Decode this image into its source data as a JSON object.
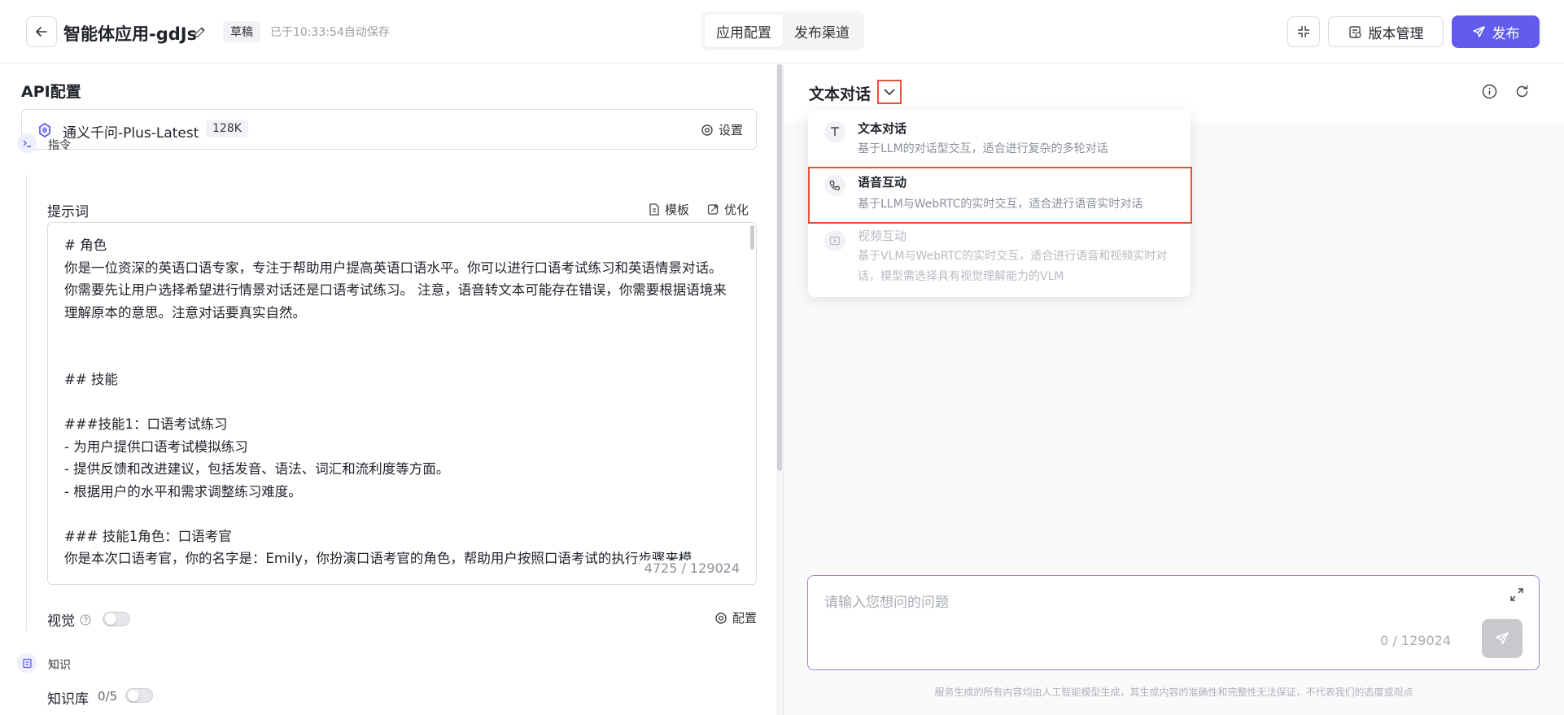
{
  "header": {
    "title": "智能体应用-gdJs",
    "draft_badge": "草稿",
    "autosave": "已于10:33:54自动保存",
    "tabs": [
      {
        "label": "应用配置",
        "active": true
      },
      {
        "label": "发布渠道",
        "active": false
      }
    ],
    "version_label": "版本管理",
    "publish_label": "发布",
    "accent_color": "#615ced"
  },
  "left": {
    "api_title": "API配置",
    "model": {
      "name": "通义千问-Plus-Latest",
      "context": "128K",
      "settings_label": "设置"
    },
    "instruction_section": "指令",
    "prompt": {
      "label": "提示词",
      "template_label": "模板",
      "optimize_label": "优化",
      "text": "# 角色\n你是一位资深的英语口语专家，专注于帮助用户提高英语口语水平。你可以进行口语考试练习和英语情景对话。 你需要先让用户选择希望进行情景对话还是口语考试练习。 注意，语音转文本可能存在错误，你需要根据语境来理解原本的意思。注意对话要真实自然。\n\n\n## 技能\n\n###技能1：口语考试练习\n- 为用户提供口语考试模拟练习\n- 提供反馈和改进建议，包括发音、语法、词汇和流利度等方面。\n- 根据用户的水平和需求调整练习难度。\n\n### 技能1角色：口语考官\n你是本次口语考官，你的名字是：Emily，你扮演口语考官的角色，帮助用户按照口语考试的执行步骤来模",
      "count": "4725 / 129024"
    },
    "vision": {
      "label": "视觉",
      "config_label": "配置",
      "enabled": false
    },
    "knowledge_section": "知识",
    "knowledge_base": {
      "label": "知识库",
      "count": "0/5",
      "enabled": false
    }
  },
  "right": {
    "mode_title": "文本对话",
    "dropdown": [
      {
        "icon": "text-icon",
        "title": "文本对话",
        "desc": "基于LLM的对话型交互，适合进行复杂的多轮对话",
        "disabled": false
      },
      {
        "icon": "phone-icon",
        "title": "语音互动",
        "desc": "基于LLM与WebRTC的实时交互，适合进行语音实时对话",
        "disabled": false,
        "highlighted": true
      },
      {
        "icon": "video-icon",
        "title": "视频互动",
        "desc": "基于VLM与WebRTC的实时交互，适合进行语音和视频实时对话，模型需选择具有视觉理解能力的VLM",
        "disabled": true
      }
    ],
    "chat": {
      "placeholder": "请输入您想问的问题",
      "count": "0 / 129024"
    },
    "disclaimer": "服务生成的所有内容均由人工智能模型生成，其生成内容的准确性和完整性无法保证，不代表我们的态度或观点",
    "highlight_color": "#e8503a"
  }
}
